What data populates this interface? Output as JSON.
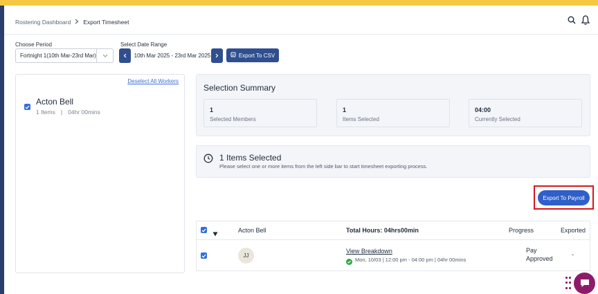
{
  "breadcrumb": {
    "parent": "Rostering Dashboard",
    "current": "Export Timesheet"
  },
  "filters": {
    "period_label": "Choose Period",
    "period_value": "Fortnight 1(10th Mar-23rd Mar)",
    "date_label": "Select Date Range",
    "date_value": "10th Mar 2025 - 23rd Mar 2025",
    "export_csv_label": "Export To CSV"
  },
  "workers": {
    "deselect_label": "Deselect All Workers",
    "items": [
      {
        "name": "Acton Bell",
        "items": "1 Items",
        "hours": "04hr 00mins"
      }
    ]
  },
  "summary": {
    "title": "Selection Summary",
    "stats": [
      {
        "value": "1",
        "label": "Selected Members"
      },
      {
        "value": "1",
        "label": "Items Selected"
      },
      {
        "value": "04:00",
        "label": "Currently Selected"
      }
    ]
  },
  "items_selected": {
    "title": "1 Items Selected",
    "desc": "Please select one or more items from the left side bar to start timesheet exporting process."
  },
  "payroll_button": "Export To Payroll",
  "table": {
    "name": "Acton Bell",
    "total_hours": "Total Hours: 04hrs00min",
    "progress_header": "Progress",
    "exported_header": "Exported",
    "row": {
      "initials": "JJ",
      "link": "View Breakdown",
      "shift": "Mon, 10/03 | 12:00 pm - 04:00 pm | 04hr 00mins",
      "progress_line1": "Pay",
      "progress_line2": "Approved",
      "exported": "-"
    }
  },
  "colors": {
    "accent": "#2f4f8f",
    "topbar": "#f5c842",
    "highlight": "#d8141b",
    "check": "#2f6fde"
  }
}
